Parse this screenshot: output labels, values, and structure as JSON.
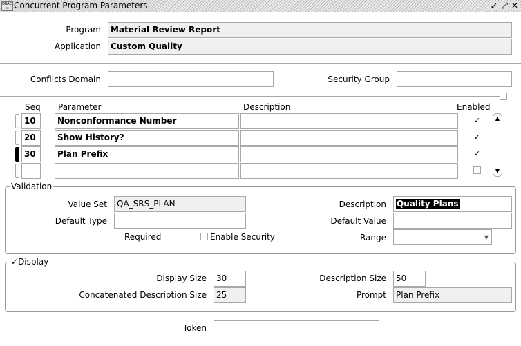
{
  "window": {
    "title": "Concurrent Program Parameters",
    "controls": [
      "↙",
      "⤢",
      "✕"
    ]
  },
  "header": {
    "program_label": "Program",
    "program_value": "Material Review Report",
    "application_label": "Application",
    "application_value": "Custom Quality",
    "conflicts_domain_label": "Conflicts Domain",
    "conflicts_domain_value": "",
    "security_group_label": "Security Group",
    "security_group_value": ""
  },
  "params_table": {
    "headers": {
      "seq": "Seq",
      "parameter": "Parameter",
      "description": "Description",
      "enabled": "Enabled"
    },
    "rows": [
      {
        "seq": "10",
        "parameter": "Nonconformance Number",
        "description": "",
        "enabled": true
      },
      {
        "seq": "20",
        "parameter": "Show History?",
        "description": "",
        "enabled": true
      },
      {
        "seq": "30",
        "parameter": "Plan Prefix",
        "description": "",
        "enabled": true
      },
      {
        "seq": "",
        "parameter": "",
        "description": "",
        "enabled": false
      }
    ],
    "current_row": 2
  },
  "validation": {
    "title": "Validation",
    "value_set_label": "Value Set",
    "value_set_value": "QA_SRS_PLAN",
    "description_label": "Description",
    "description_value": "Quality Plans",
    "default_type_label": "Default Type",
    "default_type_value": "",
    "default_value_label": "Default Value",
    "default_value_value": "",
    "required_label": "Required",
    "required_checked": false,
    "enable_security_label": "Enable Security",
    "enable_security_checked": false,
    "range_label": "Range",
    "range_value": ""
  },
  "display": {
    "title": "Display",
    "checked": true,
    "display_size_label": "Display Size",
    "display_size_value": "30",
    "description_size_label": "Description Size",
    "description_size_value": "50",
    "concat_desc_size_label": "Concatenated Description Size",
    "concat_desc_size_value": "25",
    "prompt_label": "Prompt",
    "prompt_value": "Plan Prefix"
  },
  "token": {
    "label": "Token",
    "value": ""
  },
  "icons": {
    "app_icon": "oracle-forms-icon",
    "check_mark": "✓",
    "scroll_up": "▲",
    "scroll_down": "▼",
    "dropdown": "▼"
  }
}
